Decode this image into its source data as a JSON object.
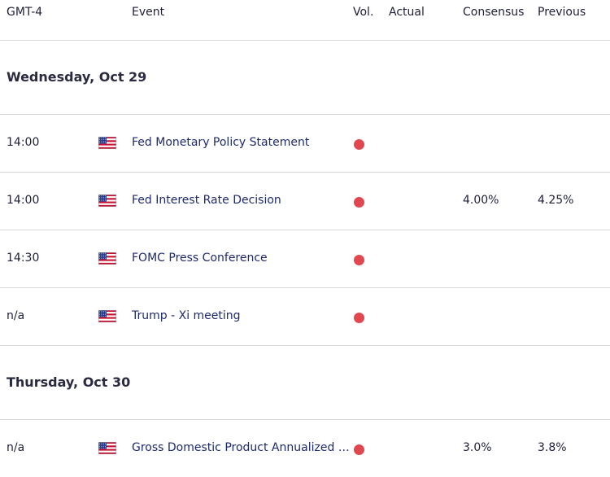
{
  "header": {
    "timezone": "GMT-4",
    "event": "Event",
    "vol": "Vol.",
    "actual": "Actual",
    "consensus": "Consensus",
    "previous": "Previous"
  },
  "colors": {
    "high_impact": "#e0474f",
    "event_text": "#1e2a6e",
    "divider": "#d7d7dc"
  },
  "days": [
    {
      "label": "Wednesday, Oct 29",
      "events": [
        {
          "time": "14:00",
          "flag": "us-flag-icon",
          "name": "Fed Monetary Policy Statement",
          "actual": "",
          "consensus": "",
          "previous": ""
        },
        {
          "time": "14:00",
          "flag": "us-flag-icon",
          "name": "Fed Interest Rate Decision",
          "actual": "",
          "consensus": "4.00%",
          "previous": "4.25%"
        },
        {
          "time": "14:30",
          "flag": "us-flag-icon",
          "name": "FOMC Press Conference",
          "actual": "",
          "consensus": "",
          "previous": ""
        },
        {
          "time": "n/a",
          "flag": "us-flag-icon",
          "name": "Trump - Xi meeting",
          "actual": "",
          "consensus": "",
          "previous": ""
        }
      ]
    },
    {
      "label": "Thursday, Oct 30",
      "events": [
        {
          "time": "n/a",
          "flag": "us-flag-icon",
          "name": "Gross Domestic Product Annualized (…",
          "actual": "",
          "consensus": "3.0%",
          "previous": "3.8%"
        }
      ]
    }
  ]
}
